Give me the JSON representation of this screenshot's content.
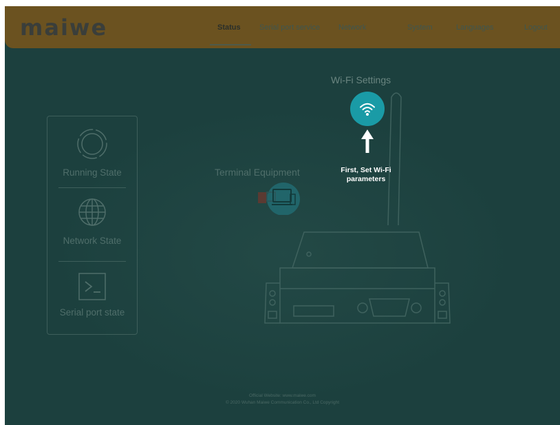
{
  "brand": {
    "logo": "maiwe"
  },
  "nav": {
    "items": [
      {
        "label": "Status",
        "active": true
      },
      {
        "label": "Serial port service",
        "active": false
      },
      {
        "label": "Network",
        "active": false
      },
      {
        "label": "System",
        "active": false
      },
      {
        "label": "Languages",
        "active": false
      },
      {
        "label": "Logout",
        "active": false
      }
    ]
  },
  "sidebar": {
    "items": [
      {
        "label": "Running State",
        "icon": "running-state-icon"
      },
      {
        "label": "Network State",
        "icon": "globe-icon"
      },
      {
        "label": "Serial port state",
        "icon": "terminal-icon"
      }
    ]
  },
  "main": {
    "wifi": {
      "title": "Wi-Fi Settings",
      "icon": "wifi-icon"
    },
    "tip": {
      "line1": "First, Set Wi-Fi",
      "line2": "parameters"
    },
    "terminal": {
      "title": "Terminal Equipment",
      "icon": "computer-icon"
    }
  },
  "footer": {
    "line1": "Official Website: www.maiwe.com",
    "line2": "© 2020 Wuhan Maiwe Communication Co., Ltd Copyright"
  },
  "colors": {
    "background": "#1c403e",
    "header": "#6b5220",
    "accent": "#1a9ba6",
    "text_muted": "#4f6e6a",
    "tip_text": "#ffffff"
  }
}
